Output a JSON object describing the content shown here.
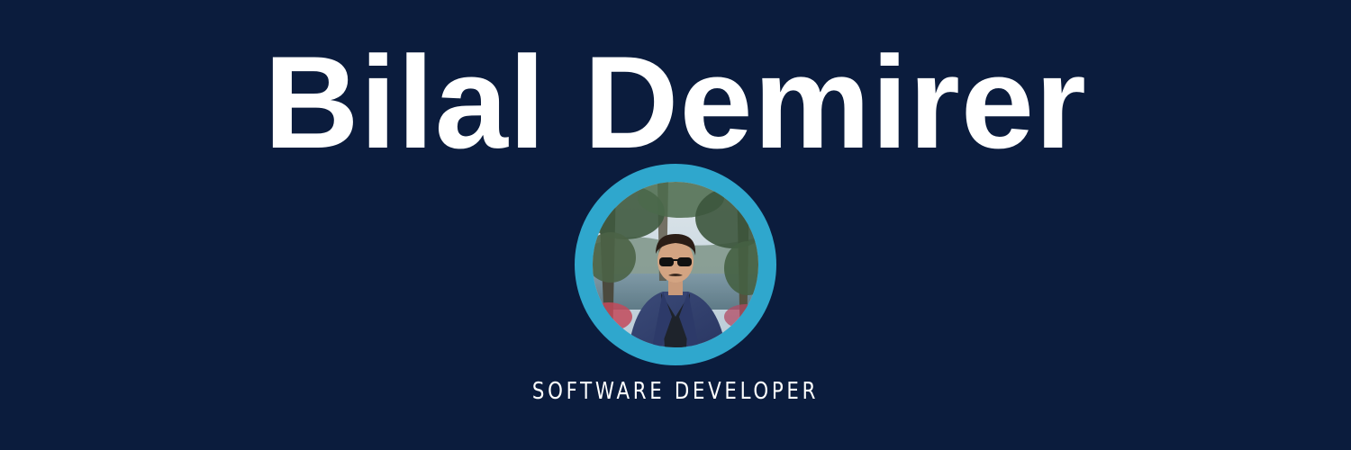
{
  "profile": {
    "name": "Bilal Demirer",
    "role": "SOFTWARE DEVELOPER"
  },
  "colors": {
    "background": "#0b1c3d",
    "accent_ring": "#2fa7cd",
    "text": "#ffffff"
  },
  "icons": {
    "avatar": "profile-photo"
  }
}
